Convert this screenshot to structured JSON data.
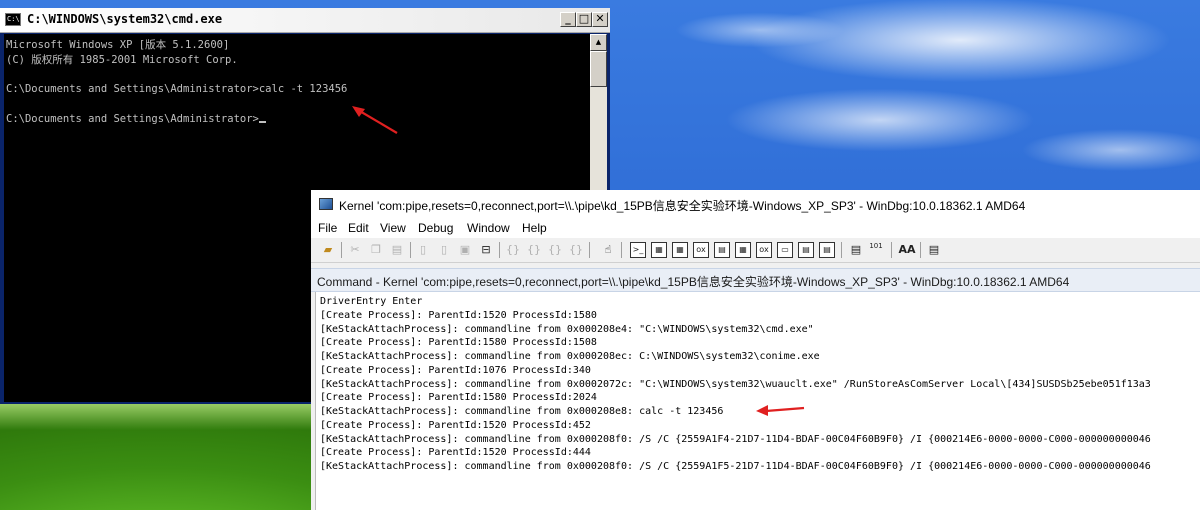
{
  "cmd_window": {
    "title": "C:\\WINDOWS\\system32\\cmd.exe",
    "icon_label": "C:\\",
    "buttons": {
      "minimize": "_",
      "maximize": "□",
      "close": "✕"
    },
    "lines": [
      "Microsoft Windows XP [版本 5.1.2600]",
      "(C) 版权所有 1985-2001 Microsoft Corp.",
      "",
      "C:\\Documents and Settings\\Administrator>calc -t 123456",
      "",
      "C:\\Documents and Settings\\Administrator>"
    ]
  },
  "windbg": {
    "title": "Kernel 'com:pipe,resets=0,reconnect,port=\\\\.\\pipe\\kd_15PB信息安全实验环境-Windows_XP_SP3' - WinDbg:10.0.18362.1 AMD64",
    "menu": [
      "File",
      "Edit",
      "View",
      "Debug",
      "Window",
      "Help"
    ],
    "toolbar_text": {
      "sources_label": "101",
      "font_label": "AA"
    },
    "command_header": "Command - Kernel 'com:pipe,resets=0,reconnect,port=\\\\.\\pipe\\kd_15PB信息安全实验环境-Windows_XP_SP3' - WinDbg:10.0.18362.1 AMD64",
    "output": [
      "DriverEntry Enter",
      "[Create Process]: ParentId:1520 ProcessId:1580",
      "[KeStackAttachProcess]: commandline from 0x000208e4: \"C:\\WINDOWS\\system32\\cmd.exe\"",
      "[Create Process]: ParentId:1580 ProcessId:1508",
      "[KeStackAttachProcess]: commandline from 0x000208ec: C:\\WINDOWS\\system32\\conime.exe",
      "[Create Process]: ParentId:1076 ProcessId:340",
      "[KeStackAttachProcess]: commandline from 0x0002072c: \"C:\\WINDOWS\\system32\\wuauclt.exe\" /RunStoreAsComServer Local\\[434]SUSDSb25ebe051f13a3",
      "[Create Process]: ParentId:1580 ProcessId:2024",
      "[KeStackAttachProcess]: commandline from 0x000208e8: calc -t 123456",
      "[Create Process]: ParentId:1520 ProcessId:452",
      "[KeStackAttachProcess]: commandline from 0x000208f0: /S /C {2559A1F4-21D7-11D4-BDAF-00C04F60B9F0} /I {000214E6-0000-0000-C000-000000000046",
      "[Create Process]: ParentId:1520 ProcessId:444",
      "[KeStackAttachProcess]: commandline from 0x000208f0: /S /C {2559A1F5-21D7-11D4-BDAF-00C04F60B9F0} /I {000214E6-0000-0000-C000-000000000046"
    ]
  },
  "colors": {
    "annotation_arrow": "#e02020",
    "cmd_text": "#c0c0c0",
    "cmd_background": "#000000"
  }
}
